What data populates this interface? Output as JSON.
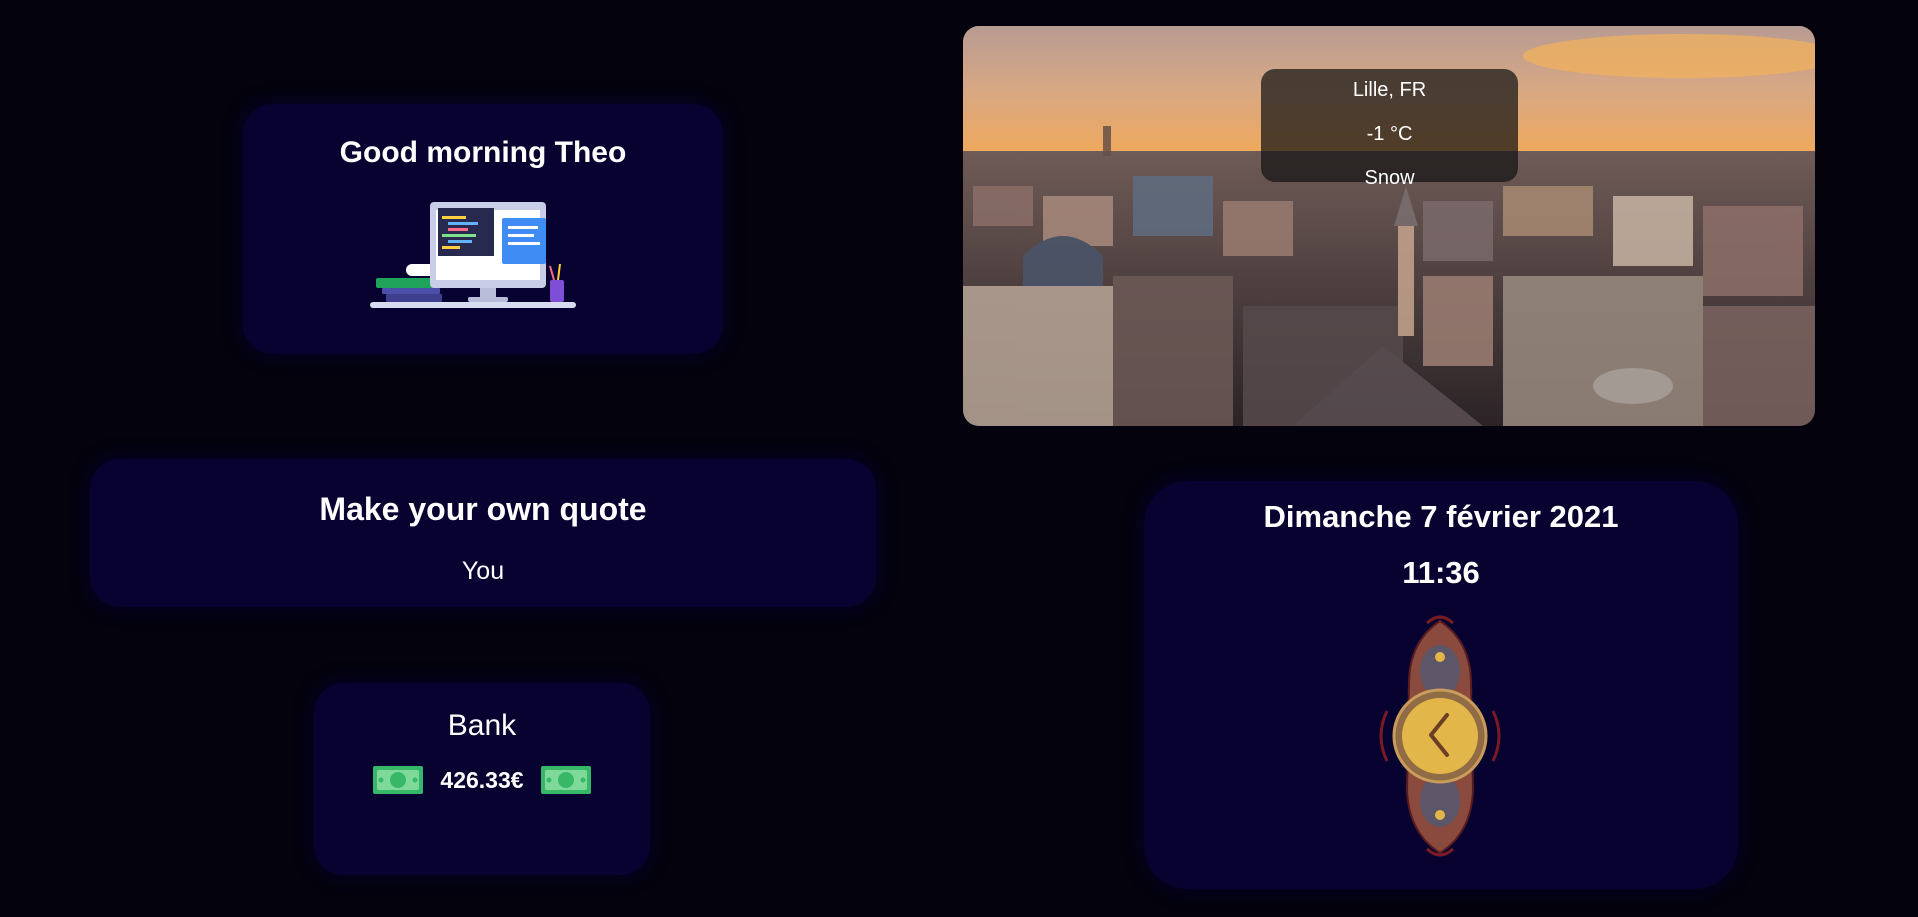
{
  "greeting": {
    "title": "Good morning Theo",
    "illustration_icon": "desktop-workspace-illustration"
  },
  "quote": {
    "title": "Make your own quote",
    "author": "You"
  },
  "bank": {
    "title": "Bank",
    "amount": "426.33€",
    "icon": "banknote-icon"
  },
  "weather": {
    "location": "Lille, FR",
    "temperature": "-1 °C",
    "condition": "Snow",
    "background_icon": "city-aerial-photo"
  },
  "datetime": {
    "date": "Dimanche 7 février 2021",
    "time": "11:36",
    "icon": "ornate-clock-icon"
  },
  "colors": {
    "page_bg": "#03020d",
    "card_bg": "#080230",
    "text": "#ffffff",
    "money_green": "#36b866"
  }
}
